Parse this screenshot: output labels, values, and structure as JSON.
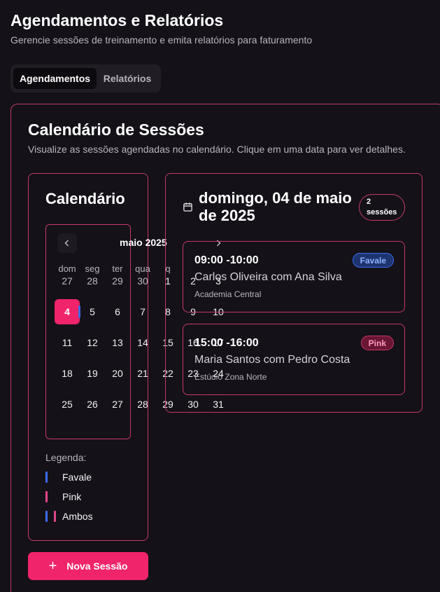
{
  "header": {
    "title": "Agendamentos e Relatórios",
    "subtitle": "Gerencie sessões de treinamento e emita relatórios para faturamento"
  },
  "tabs": [
    {
      "label": "Agendamentos",
      "active": true
    },
    {
      "label": "Relatórios",
      "active": false
    }
  ],
  "card": {
    "title": "Calendário de Sessões",
    "description": "Visualize as sessões agendadas no calendário. Clique em uma data para ver detalhes."
  },
  "calendar": {
    "heading": "Calendário",
    "month_label": "maio 2025",
    "weekdays": [
      "dom",
      "seg",
      "ter",
      "qua",
      "q"
    ],
    "weeks": [
      [
        {
          "d": "27",
          "out": true
        },
        {
          "d": "28",
          "out": true
        },
        {
          "d": "29",
          "out": true
        },
        {
          "d": "30",
          "out": true
        },
        {
          "d": "1"
        },
        {
          "d": "2"
        },
        {
          "d": "3"
        }
      ],
      [
        {
          "d": "4",
          "selected": true
        },
        {
          "d": "5"
        },
        {
          "d": "6"
        },
        {
          "d": "7"
        },
        {
          "d": "8"
        },
        {
          "d": "9"
        },
        {
          "d": "10"
        }
      ],
      [
        {
          "d": "11"
        },
        {
          "d": "12"
        },
        {
          "d": "13"
        },
        {
          "d": "14"
        },
        {
          "d": "15"
        },
        {
          "d": "16"
        },
        {
          "d": "17"
        }
      ],
      [
        {
          "d": "18"
        },
        {
          "d": "19"
        },
        {
          "d": "20"
        },
        {
          "d": "21"
        },
        {
          "d": "22"
        },
        {
          "d": "23"
        },
        {
          "d": "24"
        }
      ],
      [
        {
          "d": "25"
        },
        {
          "d": "26"
        },
        {
          "d": "27"
        },
        {
          "d": "28"
        },
        {
          "d": "29"
        },
        {
          "d": "30"
        },
        {
          "d": "31"
        }
      ]
    ],
    "prev_icon": "chevron-left-icon",
    "next_icon": "chevron-right-icon"
  },
  "legend": {
    "title": "Legenda:",
    "items": [
      {
        "label": "Favale",
        "colors": [
          "#3b6cf0"
        ]
      },
      {
        "label": "Pink",
        "colors": [
          "#e0468a"
        ]
      },
      {
        "label": "Ambos",
        "colors": [
          "#3b6cf0",
          "#e0468a"
        ]
      }
    ]
  },
  "new_session": {
    "label": "Nova Sessão",
    "icon": "plus-icon"
  },
  "detail": {
    "date_label": "domingo, 04 de maio de 2025",
    "count_number": "2",
    "count_word": "sessões",
    "sessions": [
      {
        "time": "09:00 -10:00",
        "people": "Carlos Oliveira com Ana Silva",
        "place": "Academia Central",
        "tag": "Favale"
      },
      {
        "time": "15:00 -16:00",
        "people": "Maria Santos com Pedro Costa",
        "place": "Estúdio Zona Norte",
        "tag": "Pink"
      }
    ]
  },
  "colors": {
    "background": "#141118",
    "accent": "#f0246a",
    "border": "#c43a6a",
    "favale": "#3b6cf0",
    "pink": "#e0468a"
  }
}
